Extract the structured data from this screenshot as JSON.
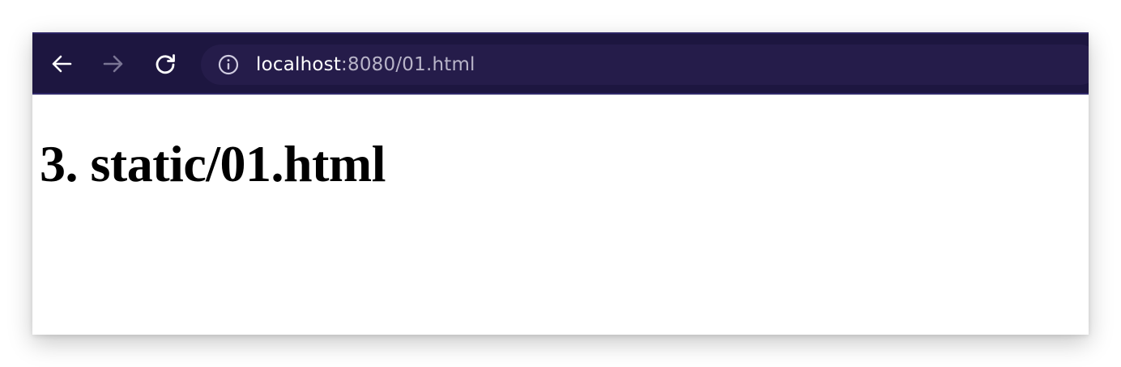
{
  "browser": {
    "nav": {
      "back_icon": "arrow-left-icon",
      "forward_icon": "arrow-right-icon",
      "reload_icon": "reload-icon"
    },
    "address_bar": {
      "site_info_icon": "info-icon",
      "host": "localhost",
      "rest": ":8080/01.html"
    },
    "colors": {
      "toolbar_bg": "#1d1640",
      "urlbar_bg": "#251c4a",
      "icon_active": "#ffffff",
      "icon_disabled": "#7a7594",
      "url_secondary": "#b8b4c8"
    }
  },
  "page": {
    "heading": "3. static/01.html"
  }
}
